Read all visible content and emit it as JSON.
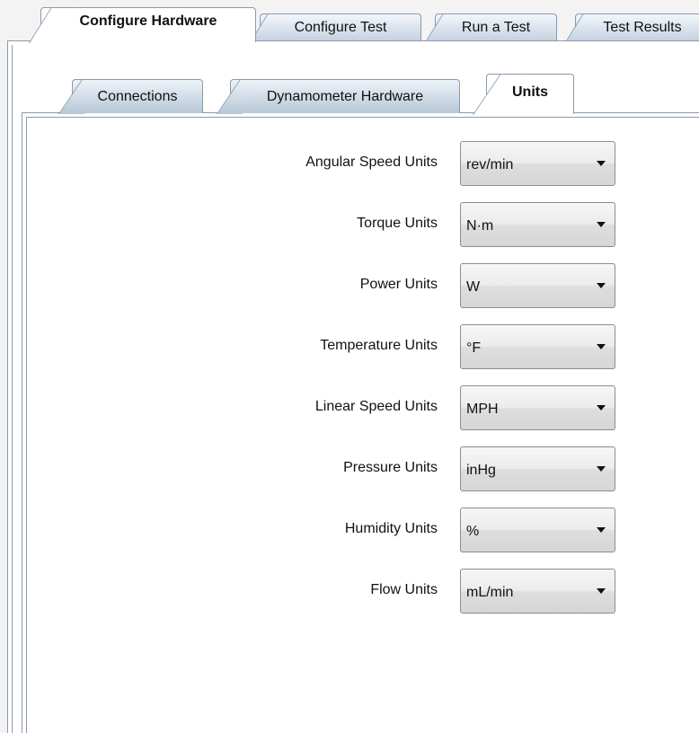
{
  "top_tabs": [
    {
      "label": "Configure Hardware",
      "active": true
    },
    {
      "label": "Configure Test",
      "active": false
    },
    {
      "label": "Run a Test",
      "active": false
    },
    {
      "label": "Test Results",
      "active": false
    }
  ],
  "inner_tabs": [
    {
      "label": "Connections",
      "active": false
    },
    {
      "label": "Dynamometer Hardware",
      "active": false
    },
    {
      "label": "Units",
      "active": true
    }
  ],
  "units": [
    {
      "label": "Angular Speed Units",
      "value": "rev/min"
    },
    {
      "label": "Torque Units",
      "value": "N·m"
    },
    {
      "label": "Power Units",
      "value": "W"
    },
    {
      "label": "Temperature Units",
      "value": "°F"
    },
    {
      "label": "Linear Speed Units",
      "value": "MPH"
    },
    {
      "label": "Pressure Units",
      "value": "inHg"
    },
    {
      "label": "Humidity Units",
      "value": "%"
    },
    {
      "label": "Flow Units",
      "value": "mL/min"
    }
  ],
  "icons": {
    "dropdown": "chevron-down-icon"
  }
}
